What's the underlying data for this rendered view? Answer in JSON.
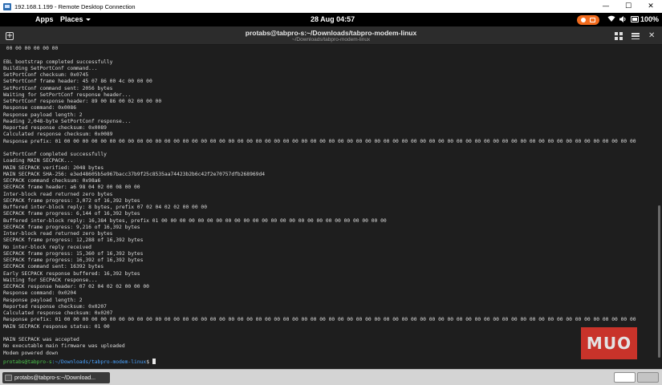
{
  "rdp": {
    "title": "192.168.1.199 - Remote Desktop Connection",
    "minimize": "—",
    "maximize": "☐",
    "close": "✕"
  },
  "topbar": {
    "apps": "Apps",
    "places": "Places",
    "clock": "28 Aug  04:57",
    "battery": "100%"
  },
  "terminal": {
    "title": "protabs@tabpro-s:~/Downloads/tabpro-modem-linux",
    "subtitle": "~/Downloads/tabpro-modem-linux",
    "lines": [
      " 00 00 00 00 00 00",
      "",
      "EBL bootstrap completed successfully",
      "Building SetPortConf command...",
      "SetPortConf checksum: 0x0745",
      "SetPortConf frame header: 45 07 86 00 4c 00 00 00",
      "SetPortConf command sent: 2056 bytes",
      "Waiting for SetPortConf response header...",
      "SetPortConf response header: 89 00 86 00 02 00 00 00",
      "Response command: 0x0086",
      "Response payload length: 2",
      "Reading 2,048-byte SetPortConf response...",
      "Reported response checksum: 0x0089",
      "Calculated response checksum: 0x0089",
      "Response prefix: 01 00 00 00 00 00 00 00 00 00 00 00 00 00 00 00 00 00 00 00 00 00 00 00 00 00 00 00 00 00 00 00 00 00 00 00 00 00 00 00 00 00 00 00 00 00 00 00 00 00 00 00 00 00 00 00 00 00 00 00 00 00 00 00",
      "",
      "SetPortConf completed successfully",
      "Loading MAIN SECPACK...",
      "MAIN SECPACK verified: 2048 bytes",
      "MAIN SECPACK SHA-256: e3ed48605b5e967bacc37b9f25c8535aa74423b2b6c42f2e70757dfb268969d4",
      "SECPACK command checksum: 0x98a6",
      "SECPACK frame header: a6 98 04 02 00 08 00 00",
      "Inter-block read returned zero bytes",
      "SECPACK frame progress: 3,072 of 16,392 bytes",
      "Buffered inter-block reply: 8 bytes, prefix 07 02 04 02 02 00 00 00",
      "SECPACK frame progress: 6,144 of 16,392 bytes",
      "Buffered inter-block reply: 16,384 bytes, prefix 01 00 00 00 00 00 00 00 00 00 00 00 00 00 00 00 00 00 00 00 00 00 00 00 00 00",
      "SECPACK frame progress: 9,216 of 16,392 bytes",
      "Inter-block read returned zero bytes",
      "SECPACK frame progress: 12,288 of 16,392 bytes",
      "No inter-block reply received",
      "SECPACK frame progress: 15,360 of 16,392 bytes",
      "SECPACK frame progress: 16,392 of 16,392 bytes",
      "SECPACK command sent: 16392 bytes",
      "Early SECPACK response buffered: 16,392 bytes",
      "Waiting for SECPACK response...",
      "SECPACK response header: 07 02 04 02 02 00 00 00",
      "Response command: 0x0204",
      "Response payload length: 2",
      "Reported response checksum: 0x0207",
      "Calculated response checksum: 0x0207",
      "Response prefix: 01 00 00 00 00 00 00 00 00 00 00 00 00 00 00 00 00 00 00 00 00 00 00 00 00 00 00 00 00 00 00 00 00 00 00 00 00 00 00 00 00 00 00 00 00 00 00 00 00 00 00 00 00 00 00 00 00 00 00 00 00 00 00 00",
      "MAIN SECPACK response status: 01 00",
      "",
      "MAIN SECPACK was accepted",
      "No executable main firmware was uploaded",
      "Modem powered down"
    ],
    "prompt_user": "protabs@tabpro-s",
    "prompt_path": ":~/Downloads/tabpro-modem-linux",
    "prompt_symbol": "$ "
  },
  "watermark": "MUO",
  "taskbar": {
    "item_label": "protabs@tabpro-s:~/Download..."
  },
  "colors": {
    "background": "#1e1e1e",
    "prompt_user": "#4ec94e",
    "prompt_path": "#4aa3ff",
    "record_indicator": "#f26b1d",
    "watermark": "#e0362c"
  }
}
